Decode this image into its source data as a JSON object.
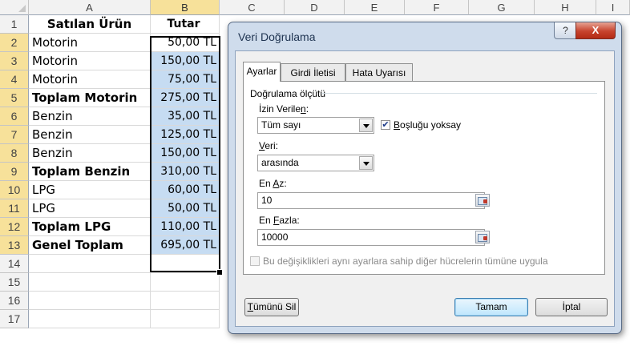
{
  "columns": [
    "A",
    "B",
    "C",
    "D",
    "E",
    "F",
    "G",
    "H",
    "I"
  ],
  "rows": [
    "1",
    "2",
    "3",
    "4",
    "5",
    "6",
    "7",
    "8",
    "9",
    "10",
    "11",
    "12",
    "13",
    "14",
    "15",
    "16",
    "17"
  ],
  "sheet": {
    "header": {
      "a": "Satılan Ürün",
      "b": "Tutar"
    },
    "data": [
      {
        "a": "Motorin",
        "b": "50,00 TL",
        "bold": false
      },
      {
        "a": "Motorin",
        "b": "150,00 TL",
        "bold": false
      },
      {
        "a": "Motorin",
        "b": "75,00 TL",
        "bold": false
      },
      {
        "a": "Toplam Motorin",
        "b": "275,00 TL",
        "bold": true
      },
      {
        "a": "Benzin",
        "b": "35,00 TL",
        "bold": false
      },
      {
        "a": "Benzin",
        "b": "125,00 TL",
        "bold": false
      },
      {
        "a": "Benzin",
        "b": "150,00 TL",
        "bold": false
      },
      {
        "a": "Toplam Benzin",
        "b": "310,00 TL",
        "bold": true
      },
      {
        "a": "LPG",
        "b": "60,00 TL",
        "bold": false
      },
      {
        "a": "LPG",
        "b": "50,00 TL",
        "bold": false
      },
      {
        "a": "Toplam LPG",
        "b": "110,00 TL",
        "bold": true
      },
      {
        "a": "Genel Toplam",
        "b": "695,00 TL",
        "bold": true
      }
    ]
  },
  "dialog": {
    "title": "Veri Doğrulama",
    "help": "?",
    "close": "X",
    "tabs": [
      "Ayarlar",
      "Girdi İletisi",
      "Hata Uyarısı"
    ],
    "group_label": "Doğrulama ölçütü",
    "allow_label_pre": "İzin Verile",
    "allow_label_ul": "n",
    "allow_label_post": ":",
    "allow_value": "Tüm sayı",
    "ignore_blank_ul": "B",
    "ignore_blank_rest": "oşluğu yoksay",
    "ignore_blank_checked": "✔",
    "data_label_ul": "V",
    "data_label_rest": "eri:",
    "data_value": "arasında",
    "min_label_pre": "En ",
    "min_label_ul": "A",
    "min_label_post": "z:",
    "min_value": "10",
    "max_label_pre": "En ",
    "max_label_ul": "F",
    "max_label_post": "azla:",
    "max_value": "10000",
    "apply_all": "Bu değişiklikleri aynı ayarlara sahip diğer hücrelerin tümüne uygula",
    "clear_all_ul": "T",
    "clear_all_rest": "ümünü Sil",
    "ok": "Tamam",
    "cancel": "İptal"
  }
}
